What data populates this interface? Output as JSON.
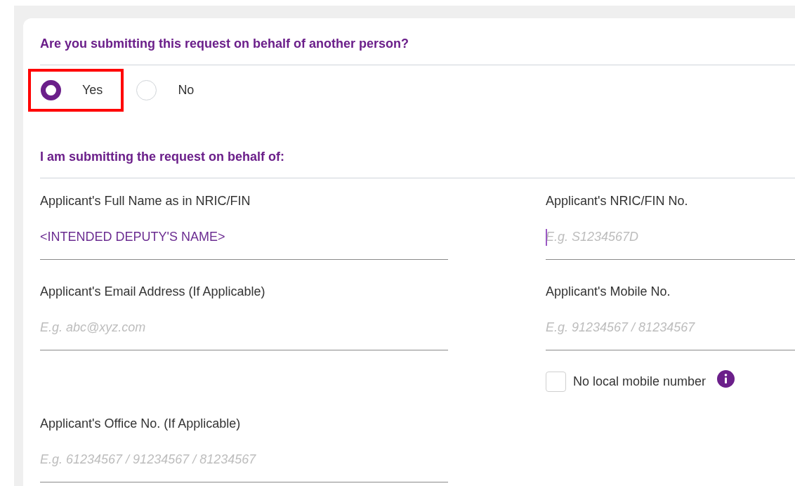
{
  "question": {
    "title": "Are you submitting this request on behalf of another person?",
    "options": [
      {
        "label": "Yes",
        "selected": true,
        "highlighted": true
      },
      {
        "label": "No",
        "selected": false,
        "highlighted": false
      }
    ]
  },
  "section": {
    "title": "I am submitting the request on behalf of:",
    "rows": [
      [
        {
          "label": "Applicant's Full Name as in NRIC/FIN",
          "value": "<INTENDED DEPUTY'S NAME>",
          "focused": false
        },
        {
          "label": "Applicant's NRIC/FIN No.",
          "placeholder": "E.g. S1234567D",
          "focused": true
        }
      ],
      [
        {
          "label": "Applicant's Email Address (If Applicable)",
          "placeholder": "E.g. abc@xyz.com",
          "focused": false
        },
        {
          "label": "Applicant's Mobile No.",
          "placeholder": "E.g. 91234567 / 81234567",
          "focused": false,
          "option": {
            "label": "No local mobile number",
            "checked": false,
            "info": true
          }
        }
      ],
      [
        {
          "label": "Applicant's Office No. (If Applicable)",
          "placeholder": "E.g. 61234567 / 91234567 / 81234567",
          "focused": false
        }
      ]
    ]
  }
}
